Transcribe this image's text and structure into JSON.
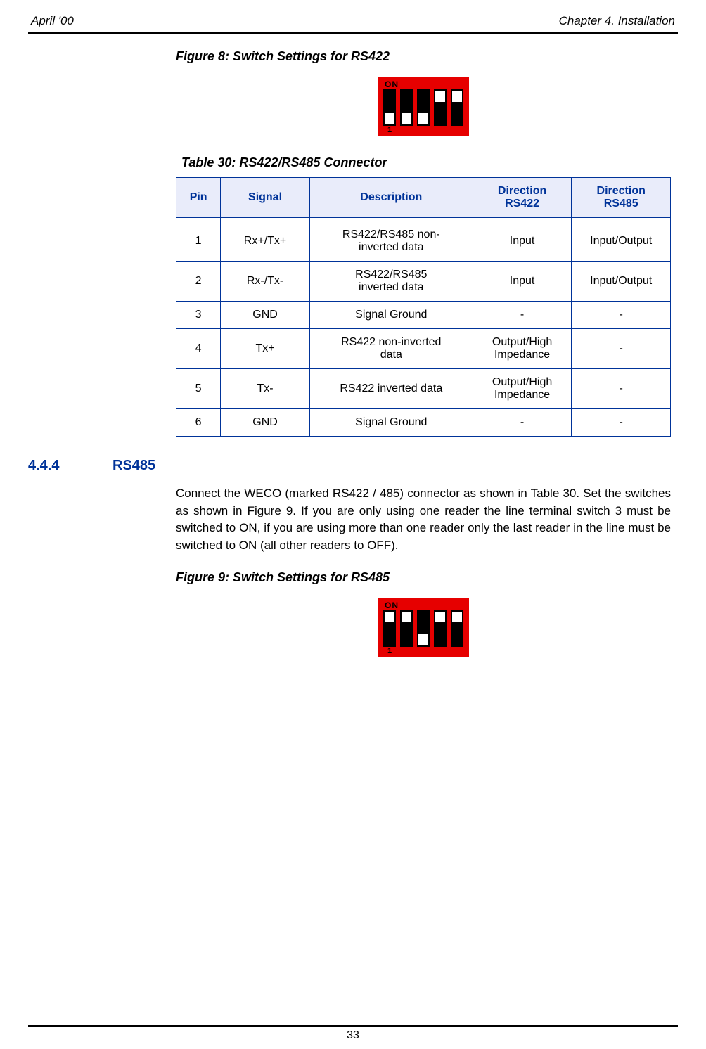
{
  "header": {
    "left": "April '00",
    "right": "Chapter 4. Installation"
  },
  "figure8": {
    "caption": "Figure 8: Switch Settings for RS422",
    "on_label": "ON",
    "one_label": "1"
  },
  "table30": {
    "caption": "Table 30: RS422/RS485 Connector",
    "headers": {
      "pin": "Pin",
      "signal": "Signal",
      "description": "Description",
      "dir422_l1": "Direction",
      "dir422_l2": "RS422",
      "dir485_l1": "Direction",
      "dir485_l2": "RS485"
    },
    "rows": [
      {
        "pin": "1",
        "signal": "Rx+/Tx+",
        "desc_l1": "RS422/RS485 non-",
        "desc_l2": "inverted data",
        "d1": "Input",
        "d2": "Input/Output"
      },
      {
        "pin": "2",
        "signal": "Rx-/Tx-",
        "desc_l1": "RS422/RS485",
        "desc_l2": "inverted data",
        "d1": "Input",
        "d2": "Input/Output"
      },
      {
        "pin": "3",
        "signal": "GND",
        "desc_l1": "Signal Ground",
        "desc_l2": "",
        "d1": "-",
        "d2": "-"
      },
      {
        "pin": "4",
        "signal": "Tx+",
        "desc_l1": "RS422 non-inverted",
        "desc_l2": "data",
        "d1_l1": "Output/High",
        "d1_l2": "Impedance",
        "d2": "-"
      },
      {
        "pin": "5",
        "signal": "Tx-",
        "desc_l1": "RS422 inverted data",
        "desc_l2": "",
        "d1_l1": "Output/High",
        "d1_l2": "Impedance",
        "d2": "-"
      },
      {
        "pin": "6",
        "signal": "GND",
        "desc_l1": "Signal Ground",
        "desc_l2": "",
        "d1": "-",
        "d2": "-"
      }
    ]
  },
  "section": {
    "num": "4.4.4",
    "title": "RS485"
  },
  "paragraph": "Connect the WECO (marked RS422 / 485) connector as shown in Table 30. Set the switches as shown in Figure 9. If you are only using one reader the line terminal switch 3 must be switched to ON, if you are using more than one reader only the last reader in the line must be switched to ON (all other readers to OFF).",
  "figure9": {
    "caption": "Figure 9: Switch Settings for RS485",
    "on_label": "ON",
    "one_label": "1"
  },
  "footer": {
    "page": "33"
  },
  "chart_data": [
    {
      "type": "table",
      "title": "Figure 8: Switch Settings for RS422 (DIP switch positions, 1=ON up, 0=OFF down)",
      "switches": [
        1,
        2,
        3,
        4,
        5
      ],
      "positions": [
        0,
        0,
        0,
        1,
        1
      ]
    },
    {
      "type": "table",
      "title": "Figure 9: Switch Settings for RS485 (DIP switch positions, 1=ON up, 0=OFF down)",
      "switches": [
        1,
        2,
        3,
        4,
        5
      ],
      "positions": [
        1,
        1,
        0,
        1,
        1
      ]
    }
  ]
}
